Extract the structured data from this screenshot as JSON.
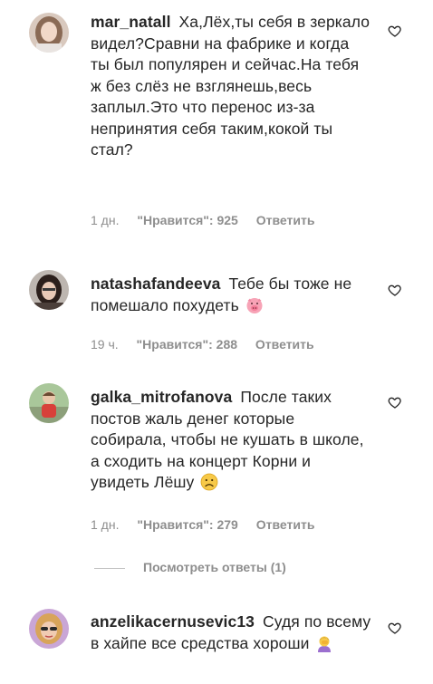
{
  "comments": [
    {
      "username": "mar_natall",
      "text": "Ха,Лёх,ты себя в зеркало видел?Сравни на фабрике и когда ты был популярен и сейчас.На тебя ж без слёз не взглянешь,весь заплыл.Это что перенос из-за непринятия себя таким,кокой ты стал?",
      "time": "1 дн.",
      "likes": "\"Нравится\": 925",
      "reply_label": "Ответить",
      "avatar_icon": "user-avatar-woman-light-hair"
    },
    {
      "username": "natashafandeeva",
      "text": "Тебе бы тоже не помешало похудеть",
      "emoji": "pig-face-emoji",
      "time": "19 ч.",
      "likes": "\"Нравится\": 288",
      "reply_label": "Ответить",
      "avatar_icon": "user-avatar-woman-dark-hair"
    },
    {
      "username": "galka_mitrofanova",
      "text": "После таких постов жаль денег которые собирала, чтобы не кушать в школе, а сходить на концерт Корни и увидеть Лёшу",
      "emoji": "sad-face-emoji",
      "time": "1 дн.",
      "likes": "\"Нравится\": 279",
      "reply_label": "Ответить",
      "avatar_icon": "user-avatar-child-red-shirt",
      "view_replies": "Посмотреть ответы (1)"
    },
    {
      "username": "anzelikacernusevic13",
      "text": "Судя по всему в хайпе все средства хороши",
      "emoji": "person-facepalming-emoji",
      "avatar_icon": "user-avatar-woman-sunglasses"
    }
  ],
  "colors": {
    "text": "#262626",
    "meta": "#8e8e8e",
    "divider": "#c4c4c4"
  },
  "icons": {
    "like": "heart-outline-icon"
  }
}
